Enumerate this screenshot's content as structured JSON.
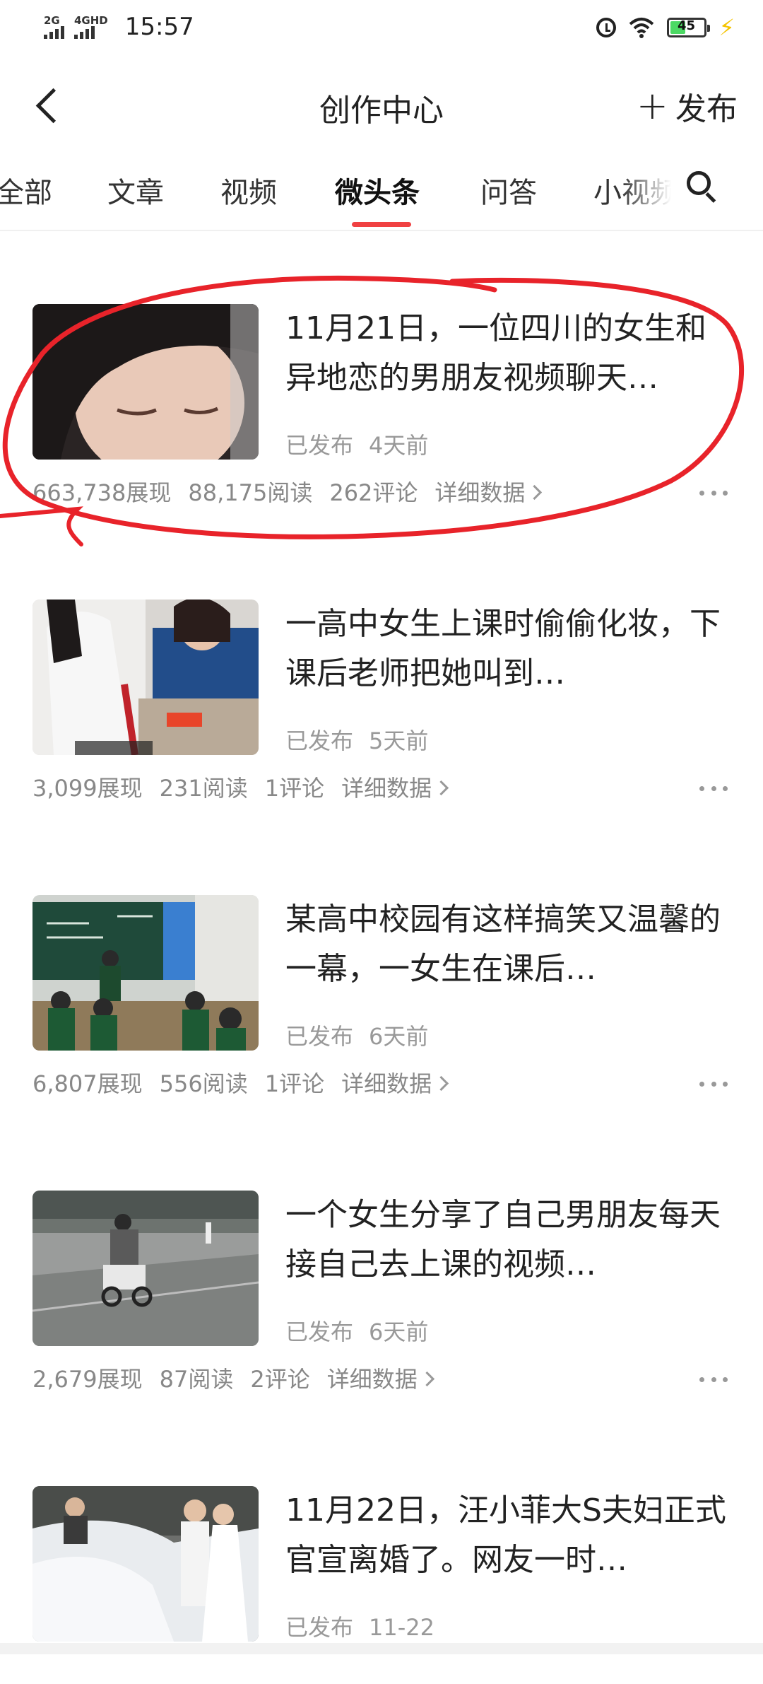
{
  "status_bar": {
    "net1": "2G",
    "net2": "4GHD",
    "time": "15:57",
    "battery": "45",
    "battery_level": 0.45
  },
  "nav": {
    "title": "创作中心",
    "publish_label": "发布"
  },
  "tabs": [
    {
      "label": "全部"
    },
    {
      "label": "文章"
    },
    {
      "label": "视频"
    },
    {
      "label": "微头条",
      "active": true
    },
    {
      "label": "问答"
    },
    {
      "label": "小视频"
    }
  ],
  "items": [
    {
      "title": "11月21日，一位四川的女生和异地恋的男朋友视频聊天…",
      "status": "已发布",
      "time": "4天前",
      "views": "663,738展现",
      "reads": "88,175阅读",
      "comments": "262评论",
      "detail": "详细数据"
    },
    {
      "title": "一高中女生上课时偷偷化妆，下课后老师把她叫到…",
      "status": "已发布",
      "time": "5天前",
      "views": "3,099展现",
      "reads": "231阅读",
      "comments": "1评论",
      "detail": "详细数据"
    },
    {
      "title": "某高中校园有这样搞笑又温馨的一幕，一女生在课后…",
      "status": "已发布",
      "time": "6天前",
      "views": "6,807展现",
      "reads": "556阅读",
      "comments": "1评论",
      "detail": "详细数据"
    },
    {
      "title": "一个女生分享了自己男朋友每天接自己去上课的视频…",
      "status": "已发布",
      "time": "6天前",
      "views": "2,679展现",
      "reads": "87阅读",
      "comments": "2评论",
      "detail": "详细数据"
    },
    {
      "title": "11月22日，汪小菲大S夫妇正式官宣离婚了。网友一时…",
      "status": "已发布",
      "time": "11-22"
    }
  ],
  "colors": {
    "accent": "#f04142",
    "annotation": "#e8232a",
    "muted": "#999999"
  }
}
